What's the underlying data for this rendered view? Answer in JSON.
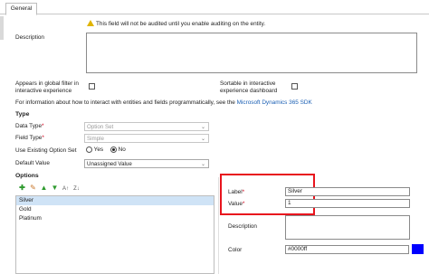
{
  "tabs": {
    "general": "General"
  },
  "audit_warning": "This field will not be audited until you enable auditing on the entity.",
  "description": {
    "label": "Description",
    "value": ""
  },
  "global_filter": {
    "label_line1": "Appears in global filter in",
    "label_line2": "interactive experience"
  },
  "sortable": {
    "label_line1": "Sortable in interactive",
    "label_line2": "experience dashboard"
  },
  "info": {
    "text": "For information about how to interact with entities and fields programmatically, see the ",
    "link": "Microsoft Dynamics 365 SDK"
  },
  "type_section": {
    "heading": "Type",
    "data_type": {
      "label": "Data Type",
      "value": "Option Set"
    },
    "field_type": {
      "label": "Field Type",
      "value": "Simple"
    },
    "use_existing": {
      "label": "Use Existing Option Set",
      "yes": "Yes",
      "no": "No",
      "selected": "No"
    },
    "default_value": {
      "label": "Default Value",
      "value": "Unassigned Value"
    }
  },
  "options_section": {
    "heading": "Options",
    "toolbar_icons": [
      "add-icon",
      "edit-icon",
      "move-up-icon",
      "move-down-icon",
      "sort-ascending-icon",
      "sort-descending-icon"
    ],
    "items": [
      "Silver",
      "Gold",
      "Platinum"
    ],
    "selected_item": "Silver"
  },
  "option_detail": {
    "label": {
      "label": "Label",
      "value": "Silver"
    },
    "value": {
      "label": "Value",
      "value": "1"
    },
    "description": {
      "label": "Description",
      "value": ""
    },
    "color": {
      "label": "Color",
      "value": "#0000ff",
      "swatch": "#0000ff"
    }
  },
  "colors": {
    "highlight_box": "#e8141d",
    "link": "#1a5fb4",
    "selection": "#cfe3f6",
    "required": "#d0021b",
    "warning": "#e0b400"
  }
}
